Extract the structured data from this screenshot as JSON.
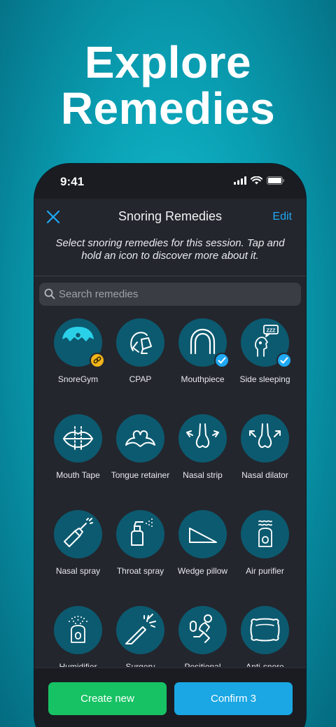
{
  "headline": {
    "line1": "Explore",
    "line2": "Remedies"
  },
  "status_bar": {
    "time": "9:41"
  },
  "nav": {
    "title": "Snoring Remedies",
    "edit_label": "Edit"
  },
  "subtitle": "Select snoring remedies for this session. Tap and hold an icon to discover more about it.",
  "search": {
    "placeholder": "Search remedies",
    "value": ""
  },
  "remedies": [
    {
      "label": "SnoreGym",
      "icon": "snoregym-icon",
      "badge": "link"
    },
    {
      "label": "CPAP",
      "icon": "cpap-mask-icon",
      "badge": ""
    },
    {
      "label": "Mouthpiece",
      "icon": "mouthpiece-icon",
      "badge": "check"
    },
    {
      "label": "Side sleeping",
      "icon": "side-sleeping-icon",
      "badge": "check"
    },
    {
      "label": "Mouth Tape",
      "icon": "mouth-tape-icon",
      "badge": ""
    },
    {
      "label": "Tongue retainer",
      "icon": "tongue-retainer-icon",
      "badge": ""
    },
    {
      "label": "Nasal strip",
      "icon": "nasal-strip-icon",
      "badge": ""
    },
    {
      "label": "Nasal dilator",
      "icon": "nasal-dilator-icon",
      "badge": ""
    },
    {
      "label": "Nasal spray",
      "icon": "nasal-spray-icon",
      "badge": ""
    },
    {
      "label": "Throat spray",
      "icon": "throat-spray-icon",
      "badge": ""
    },
    {
      "label": "Wedge pillow",
      "icon": "wedge-pillow-icon",
      "badge": ""
    },
    {
      "label": "Air purifier",
      "icon": "air-purifier-icon",
      "badge": ""
    },
    {
      "label": "Humidifier",
      "icon": "humidifier-icon",
      "badge": ""
    },
    {
      "label": "Surgery",
      "icon": "surgery-icon",
      "badge": ""
    },
    {
      "label": "Positional",
      "icon": "positional-icon",
      "badge": ""
    },
    {
      "label": "Anti-snore",
      "icon": "anti-snore-pillow-icon",
      "badge": ""
    }
  ],
  "buttons": {
    "create_new": "Create new",
    "confirm": "Confirm 3"
  },
  "colors": {
    "background": "#0a9fb3",
    "screen": "#23262d",
    "icon_circle": "#0c5a70",
    "accent_blue": "#1fa9f5",
    "create_green": "#17c264",
    "confirm_blue": "#1aa7e3",
    "badge_gold": "#f2b51a"
  }
}
